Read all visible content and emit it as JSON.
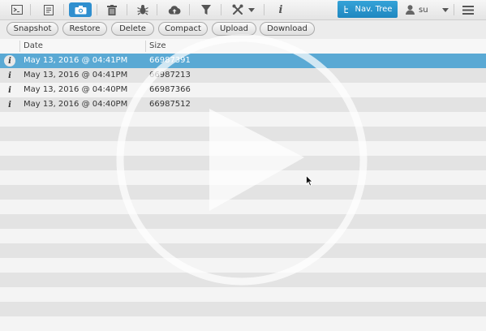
{
  "toolbar": {
    "icons": [
      "terminal-icon",
      "notes-icon",
      "camera-icon",
      "trash-icon",
      "bug-icon",
      "cloud-upload-icon",
      "filter-icon",
      "tools-icon",
      "info-icon"
    ],
    "nav_tree_label": "Nav. Tree",
    "user_name": "su"
  },
  "actions": {
    "snapshot": "Snapshot",
    "restore": "Restore",
    "delete": "Delete",
    "compact": "Compact",
    "upload": "Upload",
    "download": "Download"
  },
  "table": {
    "columns": {
      "date": "Date",
      "size": "Size"
    },
    "rows": [
      {
        "date": "May 13, 2016 @ 04:41PM",
        "size": "66987391",
        "selected": true
      },
      {
        "date": "May 13, 2016 @ 04:41PM",
        "size": "66987213",
        "selected": false
      },
      {
        "date": "May 13, 2016 @ 04:40PM",
        "size": "66987366",
        "selected": false
      },
      {
        "date": "May 13, 2016 @ 04:40PM",
        "size": "66987512",
        "selected": false
      }
    ],
    "info_glyph": "i"
  },
  "colors": {
    "accent": "#2f8fcf",
    "selected_row": "#5aa9d4",
    "stripe_light": "#f4f4f4",
    "stripe_dark": "#e3e3e3"
  }
}
